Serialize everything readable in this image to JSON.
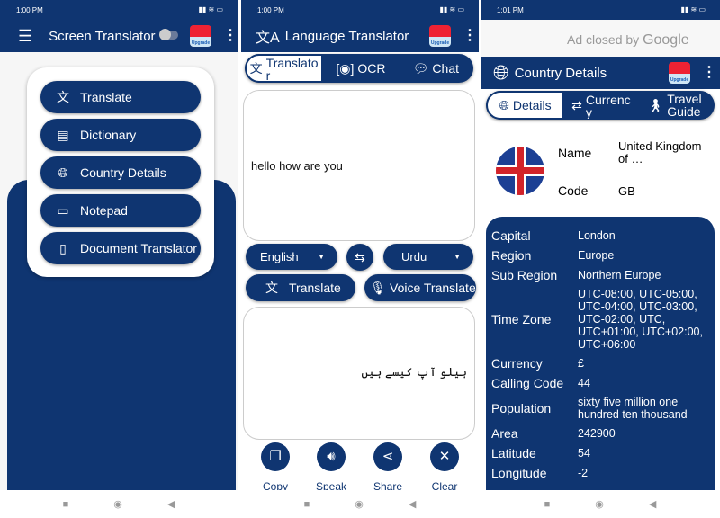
{
  "screen1": {
    "time": "1:00 PM",
    "title": "Screen Translator",
    "upgrade": "Upgrade",
    "menu": [
      {
        "icon": "translate-icon",
        "label": "Translate"
      },
      {
        "icon": "dictionary-icon",
        "label": "Dictionary"
      },
      {
        "icon": "globe-icon",
        "label": "Country Details"
      },
      {
        "icon": "notepad-icon",
        "label": "Notepad"
      },
      {
        "icon": "document-icon",
        "label": "Document Translator"
      }
    ]
  },
  "screen2": {
    "time": "1:00 PM",
    "title": "Language Translator",
    "upgrade": "Upgrade",
    "tabs": [
      "Translator",
      "OCR",
      "Chat"
    ],
    "input_text": "hello how are you",
    "source_lang": "English",
    "target_lang": "Urdu",
    "translate_label": "Translate",
    "voice_label": "Voice Translate",
    "output_text": "ہیلو آپ کیسے ہیں",
    "actions": [
      "Copy",
      "Speak",
      "Share",
      "Clear"
    ]
  },
  "screen3": {
    "time": "1:01 PM",
    "ad_text": "Ad closed by",
    "ad_brand": "Google",
    "title": "Country Details",
    "upgrade": "Upgrade",
    "tabs": [
      "Details",
      "Currency",
      "Travel Guide"
    ],
    "name_label": "Name",
    "name_value": "United Kingdom of …",
    "code_label": "Code",
    "code_value": "GB",
    "details": [
      {
        "k": "Capital",
        "v": "London"
      },
      {
        "k": "Region",
        "v": "Europe"
      },
      {
        "k": "Sub Region",
        "v": "Northern Europe"
      },
      {
        "k": "Time Zone",
        "v": "UTC-08:00, UTC-05:00, UTC-04:00, UTC-03:00, UTC-02:00, UTC, UTC+01:00, UTC+02:00, UTC+06:00"
      },
      {
        "k": "Currency",
        "v": "£"
      },
      {
        "k": "Calling Code",
        "v": "44"
      },
      {
        "k": "Population",
        "v": "sixty five million one hundred ten thousand"
      },
      {
        "k": "Area",
        "v": "242900"
      },
      {
        "k": "Latitude",
        "v": "54"
      },
      {
        "k": "Longitude",
        "v": "-2"
      }
    ]
  },
  "colors": {
    "primary": "#0f3571"
  }
}
